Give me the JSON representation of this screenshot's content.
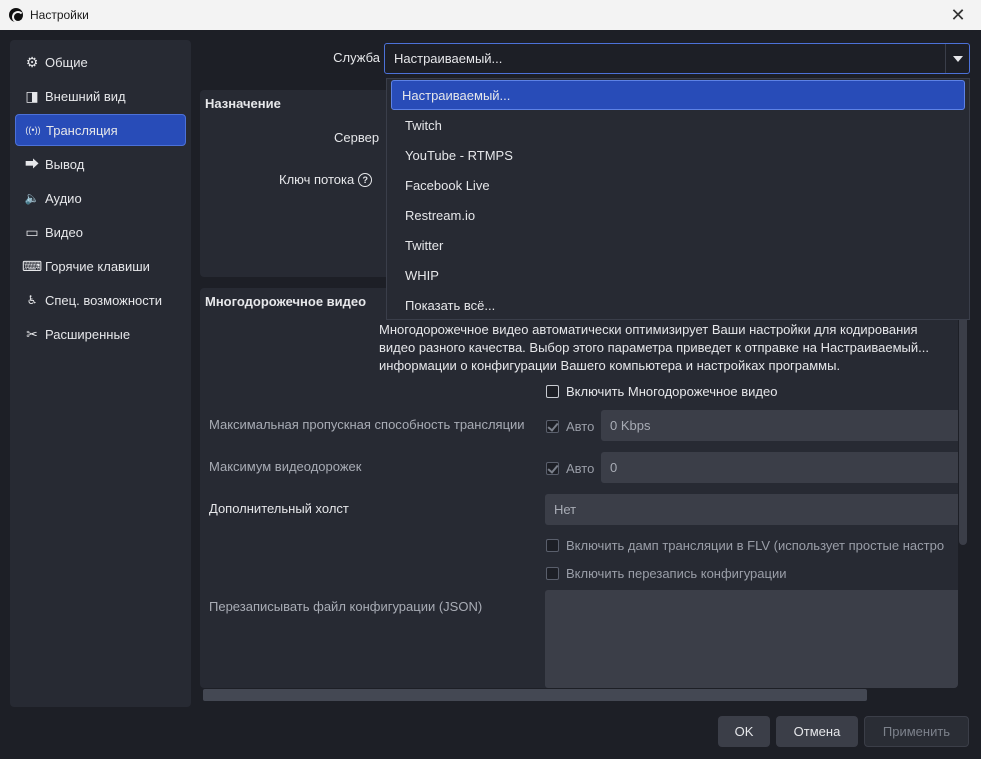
{
  "window": {
    "title": "Настройки",
    "close_glyph": "✕"
  },
  "sidebar": {
    "items": [
      {
        "label": "Общие",
        "icon": "gear-icon",
        "glyph": "⚙"
      },
      {
        "label": "Внешний вид",
        "icon": "appearance-icon",
        "glyph": "◨"
      },
      {
        "label": "Трансляция",
        "icon": "broadcast-icon",
        "glyph": "((•))"
      },
      {
        "label": "Вывод",
        "icon": "output-icon",
        "glyph": "⮕"
      },
      {
        "label": "Аудио",
        "icon": "speaker-icon",
        "glyph": "🔈"
      },
      {
        "label": "Видео",
        "icon": "monitor-icon",
        "glyph": "▭"
      },
      {
        "label": "Горячие клавиши",
        "icon": "keyboard-icon",
        "glyph": "⌨"
      },
      {
        "label": "Спец. возможности",
        "icon": "accessibility-icon",
        "glyph": "♿"
      },
      {
        "label": "Расширенные",
        "icon": "tools-icon",
        "glyph": "✂"
      }
    ],
    "active_index": 2
  },
  "stream": {
    "service_label": "Служба",
    "service_value": "Настраиваемый...",
    "destination_heading": "Назначение",
    "server_label": "Сервер",
    "stream_key_label": "Ключ потока",
    "help_glyph": "?"
  },
  "dropdown": {
    "options": [
      "Настраиваемый...",
      "Twitch",
      "YouTube - RTMPS",
      "Facebook Live",
      "Restream.io",
      "Twitter",
      "WHIP",
      "Показать всё..."
    ],
    "selected_index": 0
  },
  "multitrack": {
    "heading": "Многодорожечное видео",
    "description": "Многодорожечное видео автоматически оптимизирует Ваши настройки для кодирования видео разного качества. Выбор этого параметра приведет к отправке на Настраиваемый... информации о конфигурации Вашего компьютера и настройках программы.",
    "enable_label": "Включить Многодорожечное видео",
    "enable_checked": false,
    "max_bandwidth_label": "Максимальная пропускная способность трансляции",
    "max_bandwidth_auto_label": "Авто",
    "max_bandwidth_auto_checked": true,
    "max_bandwidth_value": "0 Kbps",
    "max_tracks_label": "Максимум видеодорожек",
    "max_tracks_auto_label": "Авто",
    "max_tracks_auto_checked": true,
    "max_tracks_value": "0",
    "extra_canvas_label": "Дополнительный холст",
    "extra_canvas_value": "Нет",
    "flv_dump_label": "Включить дамп трансляции в FLV (использует простые настро",
    "config_override_label": "Включить перезапись конфигурации",
    "override_file_label": "Перезаписывать файл конфигурации (JSON)"
  },
  "buttons": {
    "ok": "OK",
    "cancel": "Отмена",
    "apply": "Применить"
  },
  "colors": {
    "accent": "#284cb8",
    "background": "#1d1f26",
    "panel": "#272a33",
    "field": "#3b3e48"
  }
}
